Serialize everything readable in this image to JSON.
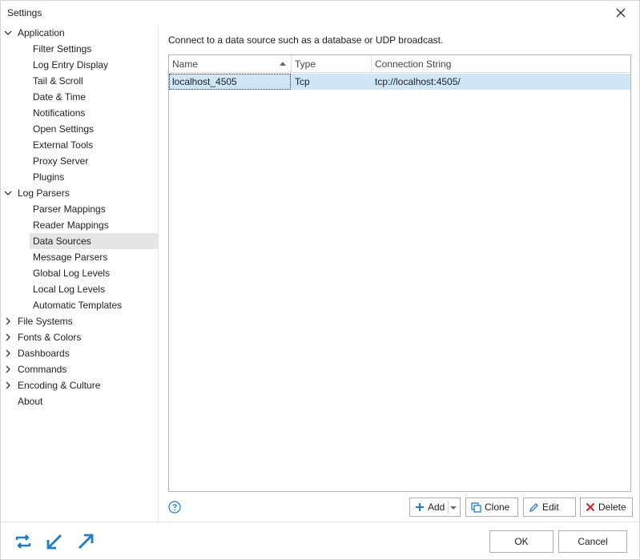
{
  "window": {
    "title": "Settings"
  },
  "sidebar": {
    "groups": [
      {
        "label": "Application",
        "expanded": true
      },
      {
        "label": "Log Parsers",
        "expanded": true
      },
      {
        "label": "File Systems"
      },
      {
        "label": "Fonts & Colors"
      },
      {
        "label": "Dashboards"
      },
      {
        "label": "Commands"
      },
      {
        "label": "Encoding & Culture"
      },
      {
        "label": "About"
      }
    ],
    "application_items": [
      "Filter Settings",
      "Log Entry Display",
      "Tail & Scroll",
      "Date & Time",
      "Notifications",
      "Open Settings",
      "External Tools",
      "Proxy Server",
      "Plugins"
    ],
    "log_parsers_items": [
      "Parser Mappings",
      "Reader Mappings",
      "Data Sources",
      "Message Parsers",
      "Global Log Levels",
      "Local Log Levels",
      "Automatic Templates"
    ],
    "selected": "Data Sources"
  },
  "content": {
    "description": "Connect to a data source such as a database or UDP broadcast.",
    "columns": [
      "Name",
      "Type",
      "Connection String"
    ],
    "rows": [
      {
        "name": "localhost_4505",
        "type": "Tcp",
        "connection": "tcp://localhost:4505/"
      }
    ],
    "buttons": {
      "add": "Add",
      "clone": "Clone",
      "edit": "Edit",
      "delete": "Delete"
    }
  },
  "footer": {
    "ok": "OK",
    "cancel": "Cancel"
  },
  "colors": {
    "accent": "#1e7cc8",
    "selection": "#cfe6f7",
    "delete": "#d42020"
  }
}
